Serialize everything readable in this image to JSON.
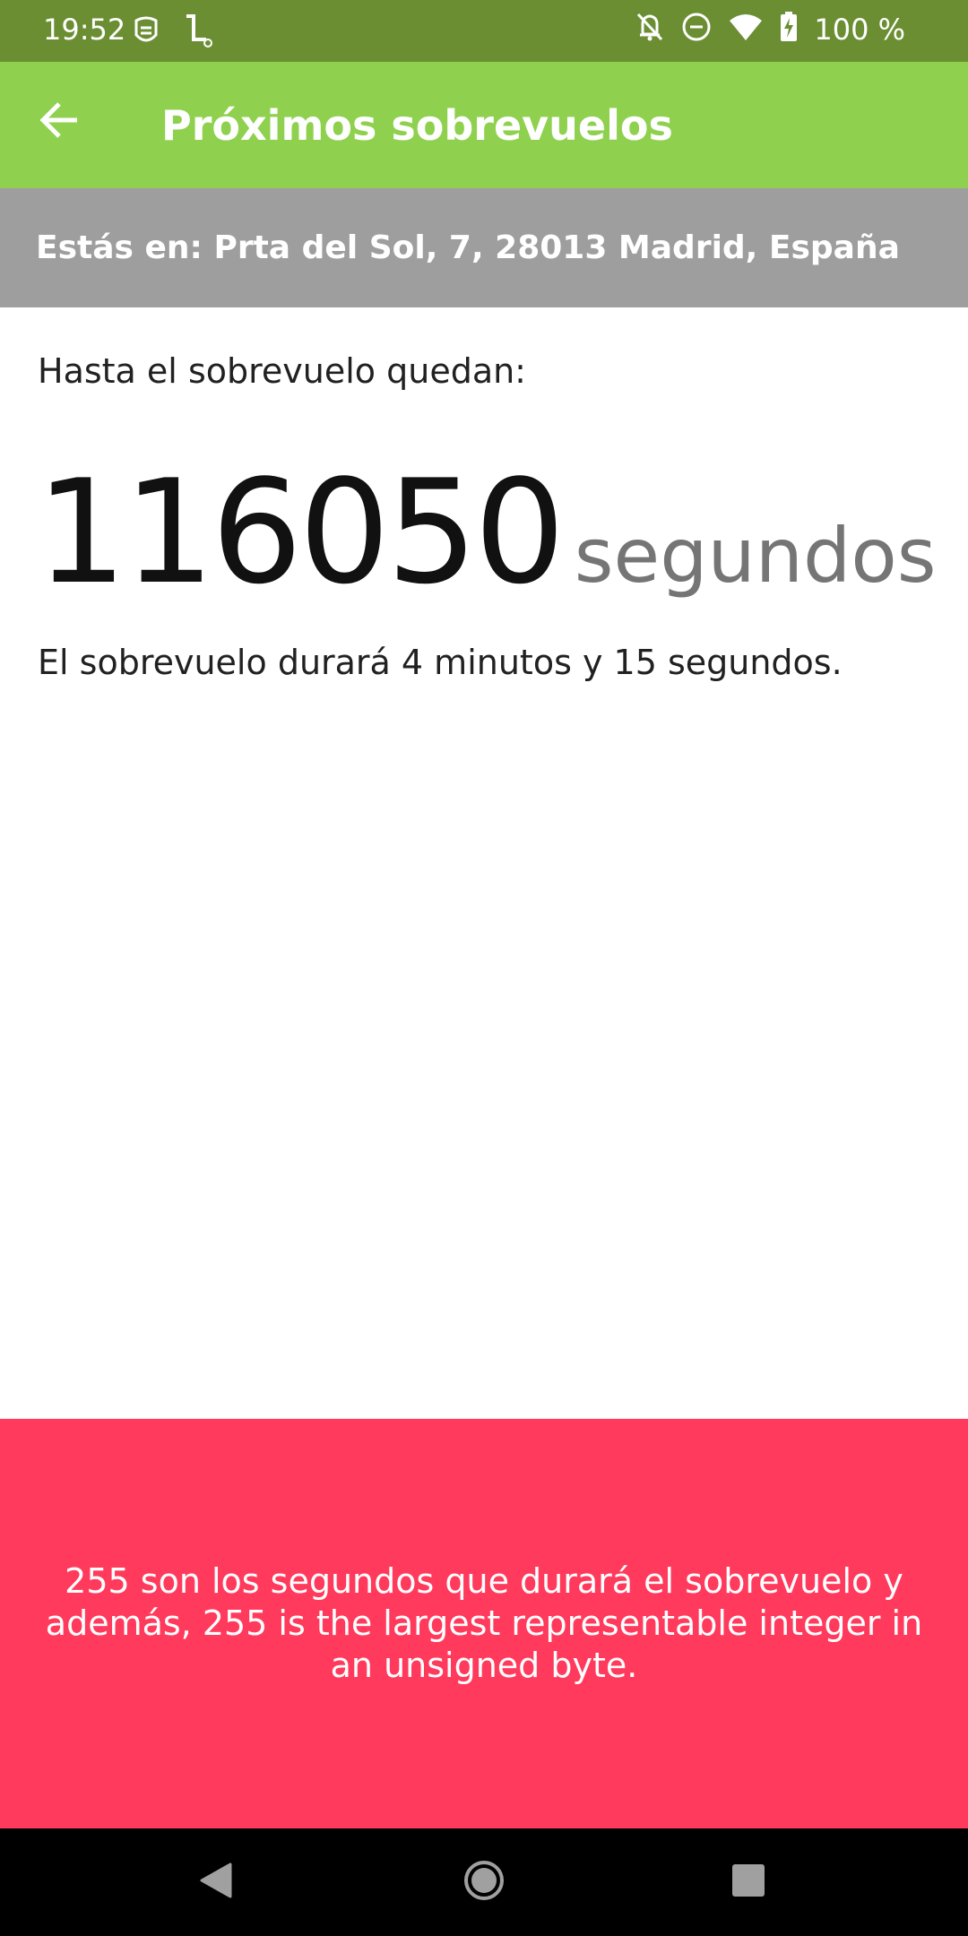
{
  "status_bar": {
    "time": "19:52",
    "left_icons": [
      "guardian-icon",
      "lambda-app-icon"
    ],
    "right_icons": [
      "notifications-off-icon",
      "do-not-disturb-icon",
      "wifi-icon",
      "battery-charging-icon"
    ],
    "battery": "100 %"
  },
  "app_bar": {
    "title": "Próximos sobrevuelos",
    "back_icon": "arrow-back-icon"
  },
  "location": {
    "text": "Estás en: Prta del Sol, 7, 28013 Madrid, España"
  },
  "content": {
    "remaining_label": "Hasta el sobrevuelo quedan:",
    "countdown_value": "116050",
    "countdown_unit": "segundos",
    "duration_text": "El sobrevuelo durará 4 minutos y 15 segundos."
  },
  "banner": {
    "text": "255 son los segundos que durará el sobrevuelo y además, 255 is the largest representable integer in an unsigned byte."
  },
  "nav_bar": {
    "buttons": [
      "back-triangle-icon",
      "home-circle-icon",
      "recents-square-icon"
    ]
  },
  "colors": {
    "status_bar": "#6b8e33",
    "app_bar": "#8fd14f",
    "location_bar": "#9e9e9e",
    "banner": "#ff3a5c",
    "nav_bar": "#000000"
  }
}
